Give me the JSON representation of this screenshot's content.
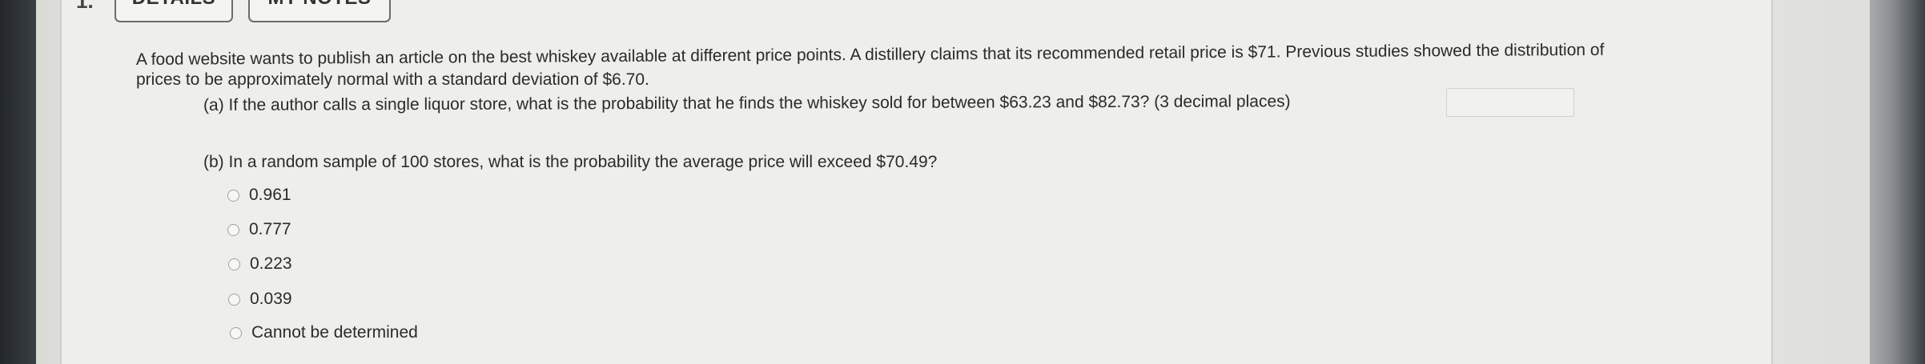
{
  "header": {
    "question_number": "1.",
    "details_label": "DETAILS",
    "my_notes_label": "MY NOTES"
  },
  "question": {
    "stem_line1": "A food website wants to publish an article on the best whiskey available at different price points. A distillery claims that its recommended retail price is $71. Previous studies showed the distribution of",
    "stem_line2": "prices to be approximately normal with a standard deviation of $6.70.",
    "part_a": "(a) If the author calls a single liquor store, what is the probability that he finds the whiskey sold for between $63.23 and $82.73? (3 decimal places)",
    "part_a_answer": "",
    "part_b": "(b) In a random sample of 100 stores, what is the probability the average price will exceed $70.49?",
    "options": [
      "0.961",
      "0.777",
      "0.223",
      "0.039",
      "Cannot be determined"
    ]
  }
}
